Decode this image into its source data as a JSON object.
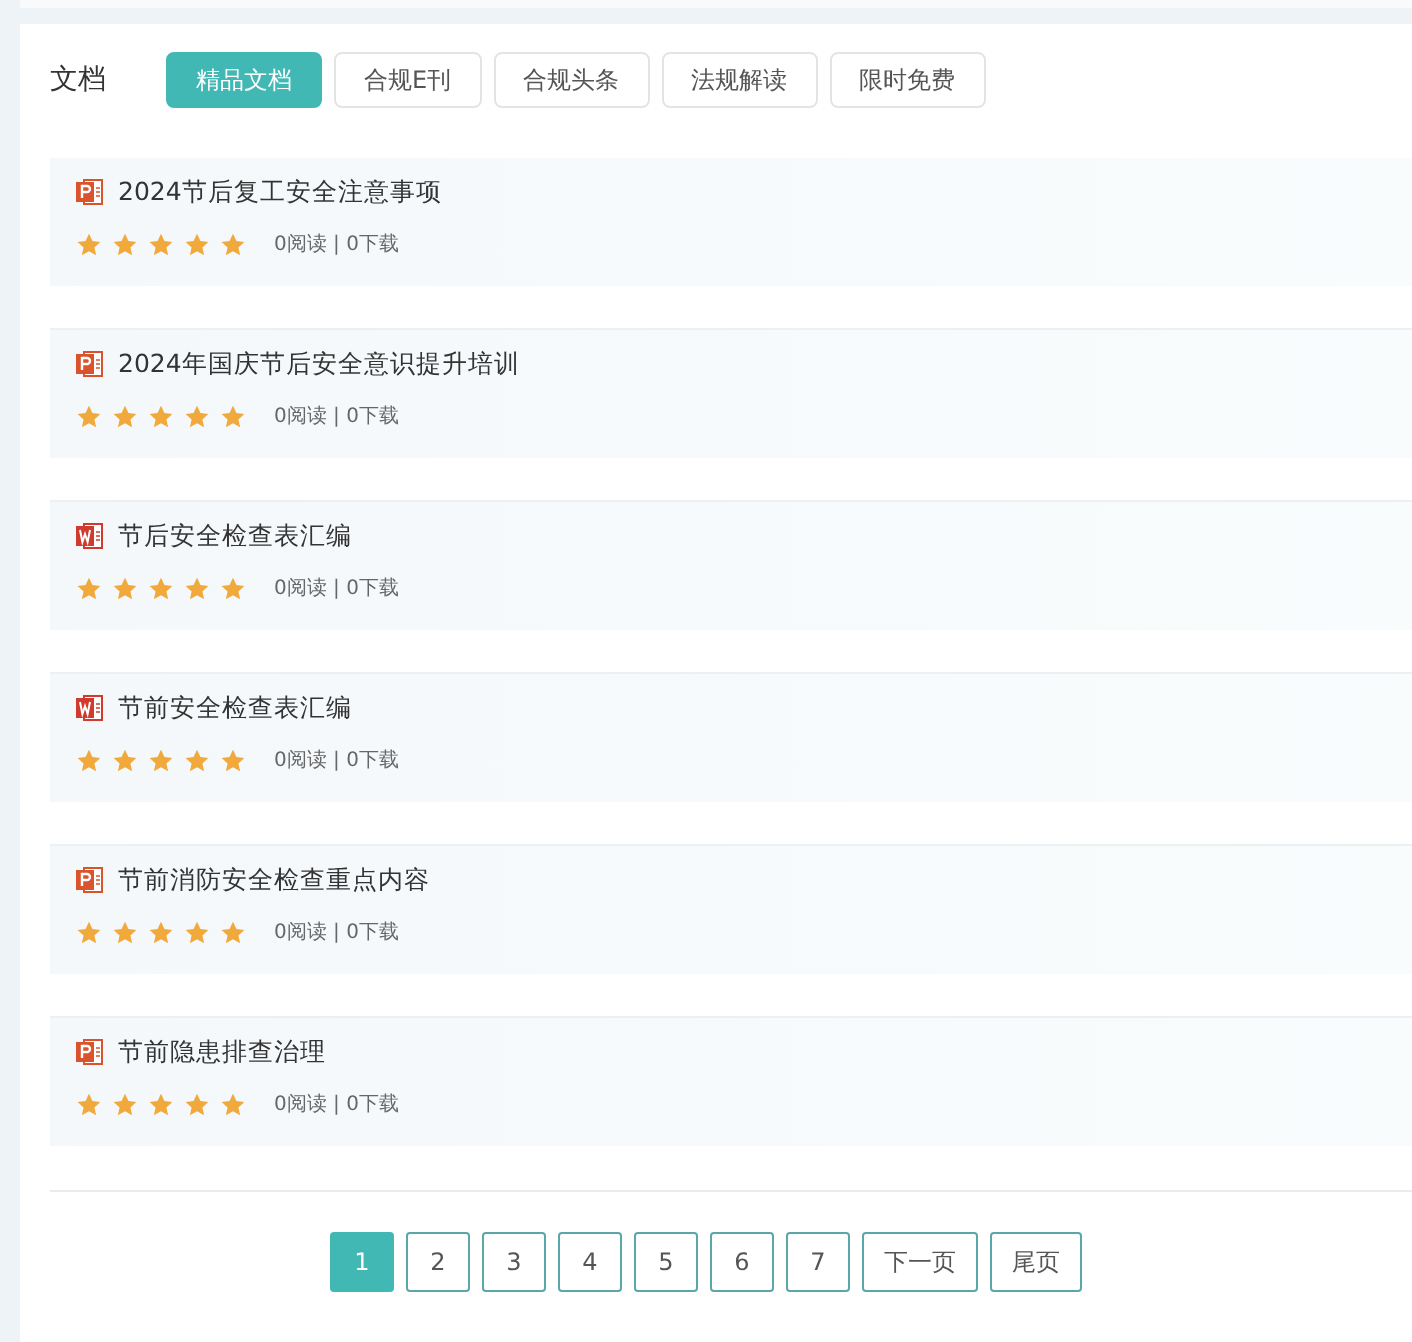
{
  "section_label": "文档",
  "tabs": [
    {
      "label": "精品文档",
      "selected": true
    },
    {
      "label": "合规E刊",
      "selected": false
    },
    {
      "label": "合规头条",
      "selected": false
    },
    {
      "label": "法规解读",
      "selected": false
    },
    {
      "label": "限时免费",
      "selected": false
    }
  ],
  "documents": [
    {
      "kind": "ppt",
      "title": "2024节后复工安全注意事项",
      "stars": 5,
      "stats": "0阅读 | 0下载"
    },
    {
      "kind": "ppt",
      "title": "2024年国庆节后安全意识提升培训",
      "stars": 5,
      "stats": "0阅读 | 0下载"
    },
    {
      "kind": "word",
      "title": "节后安全检查表汇编",
      "stars": 5,
      "stats": "0阅读 | 0下载"
    },
    {
      "kind": "word",
      "title": "节前安全检查表汇编",
      "stars": 5,
      "stats": "0阅读 | 0下载"
    },
    {
      "kind": "ppt",
      "title": "节前消防安全检查重点内容",
      "stars": 5,
      "stats": "0阅读 | 0下载"
    },
    {
      "kind": "ppt",
      "title": "节前隐患排查治理",
      "stars": 5,
      "stats": "0阅读 | 0下载"
    }
  ],
  "pagination": [
    {
      "label": "1",
      "selected": true
    },
    {
      "label": "2",
      "selected": false
    },
    {
      "label": "3",
      "selected": false
    },
    {
      "label": "4",
      "selected": false
    },
    {
      "label": "5",
      "selected": false
    },
    {
      "label": "6",
      "selected": false
    },
    {
      "label": "7",
      "selected": false
    },
    {
      "label": "下一页",
      "selected": false
    },
    {
      "label": "尾页",
      "selected": false
    }
  ]
}
